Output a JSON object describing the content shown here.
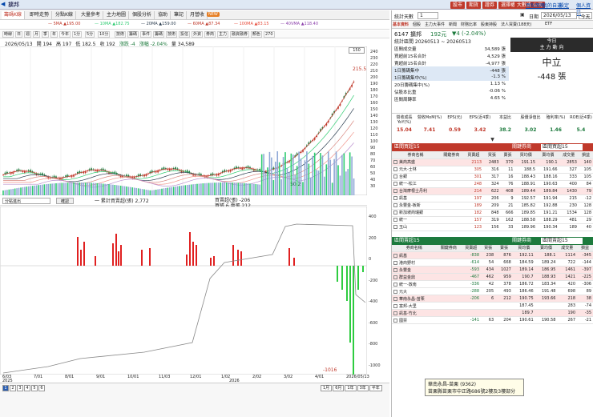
{
  "app": {
    "title": "擴邦",
    "pills": [
      "股市",
      "期貨",
      "證券",
      "選擇權",
      "大數據",
      "公司"
    ],
    "links": [
      "買點策略",
      "我的自選",
      "設定",
      "個人資訊"
    ]
  },
  "toolbar1": [
    "籌碼K線",
    "即時走勢",
    "分點K線",
    "大量參考",
    "主力地圖",
    "個股分析",
    "協助",
    "筆記",
    "月營收"
  ],
  "toolbar3": [
    "時線",
    "日",
    "週",
    "月",
    "季",
    "年",
    "今年",
    "1分",
    "5分",
    "10分",
    "技術",
    "籌碼",
    "事件",
    "籌碼",
    "技術",
    "投信",
    "外資",
    "券商",
    "主力",
    "融資融券",
    "顏色",
    "270"
  ],
  "info": {
    "date": "2026/05/13",
    "open": "開 194",
    "high": "高 197",
    "low": "低 182.5",
    "close": "收 192",
    "change": "漲跌 -4",
    "pct": "漲幅 -2.04%",
    "vol": "量 34,589"
  },
  "ma": [
    "5MA ▲195.00",
    "10MA ▲182.75",
    "20MA ▲159.00",
    "60MA ▲87.34",
    "100MA ▲83.15",
    "40VMA ▲118.40"
  ],
  "mainYTicks": [
    "240",
    "230",
    "220",
    "210",
    "200",
    "190",
    "180",
    "170",
    "160",
    "150",
    "140",
    "130",
    "120",
    "110",
    "100",
    "90",
    "80",
    "70",
    "60",
    "50",
    "40",
    "30"
  ],
  "subYTicks": [
    "400",
    "200",
    "0",
    "-200",
    "-400",
    "-600",
    "-800",
    "-1000",
    "-1200"
  ],
  "peakLabel": "215.5",
  "lowLabel": "50.2",
  "lastLabel": "-1016",
  "sub": {
    "select": "分點進出",
    "btn": "確認",
    "label1": "一 累計買賣超(張) 2,772",
    "label2": "買賣超(張) -206",
    "label3": "買張 6 賣張 212"
  },
  "xLabels": [
    "6/03",
    "7/01",
    "8/01",
    "9/01",
    "10/01",
    "11/03",
    "12/01",
    "1/02",
    "2/02",
    "3/02",
    "4/01",
    "2026/05/13"
  ],
  "xYears": [
    "2025",
    "2026"
  ],
  "pages": [
    "1",
    "2",
    "3",
    "4",
    "5",
    "6"
  ],
  "navBtns": [
    "1月",
    "6月",
    "1年",
    "3年",
    "半年"
  ],
  "rp": {
    "count": "統計天數",
    "countVal": "1",
    "date": "2026/05/13",
    "today": "今天",
    "tabs": [
      "基本資料",
      "個股",
      "主力大事件",
      "新聞",
      "財務比率",
      "股東持股",
      "法人買賣(188天)",
      "ETF"
    ],
    "stockName": "6147 擴邦",
    "price": "192元",
    "chg": "▼4 (-2.04%)",
    "periodLabel": "統計區間",
    "period": "20260513 ~ 20260513",
    "stats": [
      [
        "區間成交量",
        "34,589 張"
      ],
      [
        "買超前15名合計",
        "4,529 張"
      ],
      [
        "賣超前15名合計",
        "-4,977 張"
      ],
      [
        "1日籌碼集中",
        "-448 張"
      ],
      [
        "1日籌碼集中(%)",
        "-1.3 %"
      ],
      [
        "20日籌碼集中(%)",
        "1.13 %"
      ],
      [
        "佔股本比重",
        "-0.06 %"
      ],
      [
        "區間周轉率",
        "4.65 %"
      ]
    ],
    "today2": "今日",
    "mainDir": "主 力 動 向",
    "neutral": "中立",
    "neutralVal": "-448 張",
    "fin": [
      [
        "營收成長YoY(%)",
        "15.04"
      ],
      [
        "營收MoM(%)",
        "7.41"
      ],
      [
        "EPS(元)",
        "0.59"
      ],
      [
        "EPS(近4季)",
        "3.42"
      ],
      [
        "本益比",
        "38.2"
      ],
      [
        "股價淨值比",
        "3.02"
      ],
      [
        "殖利率(%)",
        "1.46"
      ],
      [
        "ROE(近4季)",
        "5.4"
      ]
    ],
    "buyHdr": "區間買超15",
    "buyFilter": "關鍵券商",
    "buyFilter2": "區間買超15",
    "cols": [
      "券商名稱",
      "關鍵券商",
      "買賣超",
      "買張",
      "賣張",
      "買均價",
      "賣均價",
      "成交量",
      "損益"
    ],
    "buy": [
      [
        "美商高盛",
        "",
        "2113",
        "2483",
        "370",
        "191.15",
        "190.1",
        "2853",
        "140"
      ],
      [
        "元大-士林",
        "",
        "305",
        "316",
        "11",
        "188.5",
        "191.66",
        "327",
        "105"
      ],
      [
        "台銀",
        "",
        "301",
        "317",
        "16",
        "188.43",
        "188.16",
        "333",
        "105"
      ],
      [
        "統一-松江",
        "",
        "248",
        "324",
        "76",
        "188.91",
        "190.63",
        "400",
        "84"
      ],
      [
        "台灣摩根士丹利",
        "",
        "214",
        "622",
        "408",
        "189.44",
        "189.84",
        "1430",
        "79"
      ],
      [
        "凱基",
        "",
        "197",
        "206",
        "9",
        "192.57",
        "191.94",
        "215",
        "-12"
      ],
      [
        "永豐金-板新",
        "",
        "189",
        "209",
        "21",
        "185.82",
        "192.88",
        "230",
        "128"
      ],
      [
        "新加坡商瑞銀",
        "",
        "182",
        "848",
        "666",
        "189.85",
        "191.21",
        "1534",
        "128"
      ],
      [
        "統一",
        "",
        "157",
        "319",
        "162",
        "188.58",
        "188.29",
        "481",
        "29"
      ],
      [
        "玉山",
        "",
        "123",
        "156",
        "33",
        "189.96",
        "190.34",
        "189",
        "40"
      ]
    ],
    "sellHdr": "區間賣超15",
    "sellFilter": "關鍵券商",
    "sellFilter2": "區間賣超15",
    "sell": [
      [
        "凱基",
        "",
        "-838",
        "238",
        "876",
        "192.11",
        "188.1",
        "1114",
        "-345"
      ],
      [
        "港商野村",
        "",
        "-614",
        "54",
        "668",
        "184.59",
        "189.24",
        "722",
        "-144"
      ],
      [
        "永豐金",
        "",
        "-593",
        "434",
        "1027",
        "189.14",
        "186.95",
        "1461",
        "-397"
      ],
      [
        "群益金鼎",
        "",
        "-467",
        "462",
        "959",
        "190.7",
        "188.93",
        "1421",
        "-225"
      ],
      [
        "統一-敦南",
        "",
        "-336",
        "42",
        "378",
        "186.72",
        "183.34",
        "420",
        "-306"
      ],
      [
        "元大",
        "",
        "-288",
        "205",
        "493",
        "186.46",
        "191.48",
        "698",
        "89"
      ],
      [
        "華南永昌-苗栗",
        "",
        "-206",
        "6",
        "212",
        "190.75",
        "193.66",
        "218",
        "38"
      ],
      [
        "富邦-大里",
        "",
        "",
        "",
        "",
        "187.45",
        "",
        "283",
        "-74"
      ],
      [
        "凱基-竹北",
        "",
        "",
        "",
        "",
        "189.7",
        "",
        "190",
        "-35"
      ],
      [
        "國票",
        "",
        "-141",
        "63",
        "204",
        "190.61",
        "190.58",
        "267",
        "-21"
      ]
    ],
    "tooltip": "華南永昌-苗栗 (9362)\n苗栗縣苗栗市中正路686號2樓及3樓部分"
  }
}
